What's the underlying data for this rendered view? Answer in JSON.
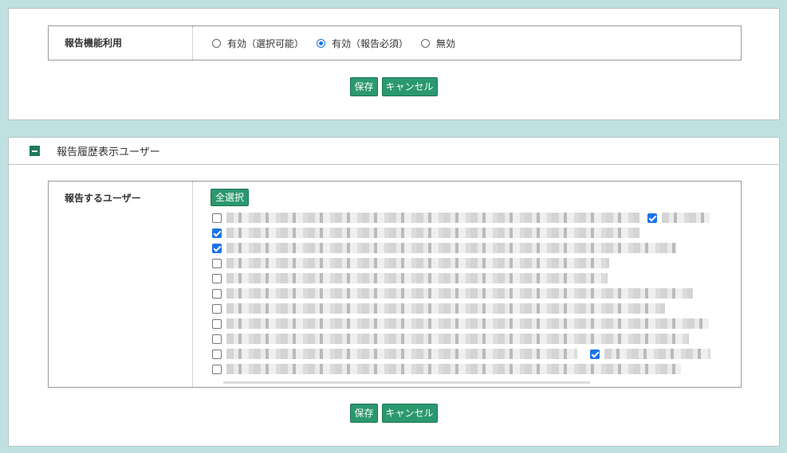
{
  "panel1": {
    "label": "報告機能利用",
    "options": [
      {
        "label": "有効（選択可能）",
        "checked": false
      },
      {
        "label": "有効（報告必須）",
        "checked": true
      },
      {
        "label": "無効",
        "checked": false
      }
    ],
    "save_label": "保存",
    "cancel_label": "キャンセル"
  },
  "panel2": {
    "title": "報告履歴表示ユーザー",
    "label": "報告するユーザー",
    "select_all_label": "全選択",
    "users": [
      {
        "checked": false,
        "extra_checked": true
      },
      {
        "checked": true
      },
      {
        "checked": true
      },
      {
        "checked": false
      },
      {
        "checked": false
      },
      {
        "checked": false
      },
      {
        "checked": false
      },
      {
        "checked": false
      },
      {
        "checked": false
      },
      {
        "checked": false,
        "extra_checked": true
      },
      {
        "checked": false
      }
    ],
    "save_label": "保存",
    "cancel_label": "キャンセル"
  },
  "colors": {
    "background": "#bfe1e1",
    "button": "#2b9870",
    "accent": "#1a73e8",
    "toggle": "#1e7a5a"
  }
}
